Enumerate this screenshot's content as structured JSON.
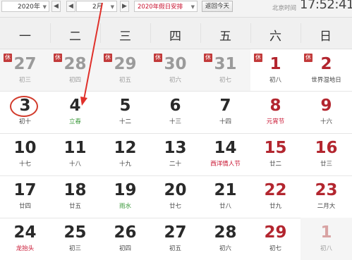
{
  "toolbar": {
    "year": "2020年",
    "month": "2月",
    "holiday_select": "2020年假日安排",
    "today_button": "返回今天",
    "timezone_label": "北京时间",
    "clock": "17:52:41",
    "prev_icon": "chevron-left-icon",
    "next_icon": "chevron-right-icon",
    "dropdown_icon": "caret-down-icon"
  },
  "weekdays": [
    "一",
    "二",
    "三",
    "四",
    "五",
    "六",
    "日"
  ],
  "colors": {
    "accent_red": "#c8102e",
    "weekend_red": "#b3262f",
    "solar_term_green": "#3d9a3d",
    "circle_red": "#d23b2c"
  },
  "rows": [
    [
      {
        "day": "27",
        "lunar": "初三",
        "badge": "休",
        "prev": true
      },
      {
        "day": "28",
        "lunar": "初四",
        "badge": "休",
        "prev": true
      },
      {
        "day": "29",
        "lunar": "初五",
        "badge": "休",
        "prev": true
      },
      {
        "day": "30",
        "lunar": "初六",
        "badge": "休",
        "prev": true
      },
      {
        "day": "31",
        "lunar": "初七",
        "badge": "休",
        "prev": true
      },
      {
        "day": "1",
        "lunar": "初八",
        "badge": "休"
      },
      {
        "day": "2",
        "lunar": "世界湿地日",
        "badge": "休"
      }
    ],
    [
      {
        "day": "3",
        "lunar": "初十",
        "circled": true
      },
      {
        "day": "4",
        "lunar": "立春",
        "kind": "term"
      },
      {
        "day": "5",
        "lunar": "十二"
      },
      {
        "day": "6",
        "lunar": "十三"
      },
      {
        "day": "7",
        "lunar": "十四"
      },
      {
        "day": "8",
        "lunar": "元宵节",
        "kind": "festival"
      },
      {
        "day": "9",
        "lunar": "十六"
      }
    ],
    [
      {
        "day": "10",
        "lunar": "十七"
      },
      {
        "day": "11",
        "lunar": "十八"
      },
      {
        "day": "12",
        "lunar": "十九"
      },
      {
        "day": "13",
        "lunar": "二十"
      },
      {
        "day": "14",
        "lunar": "西洋情人节",
        "kind": "festival"
      },
      {
        "day": "15",
        "lunar": "廿二"
      },
      {
        "day": "16",
        "lunar": "廿三"
      }
    ],
    [
      {
        "day": "17",
        "lunar": "廿四"
      },
      {
        "day": "18",
        "lunar": "廿五"
      },
      {
        "day": "19",
        "lunar": "雨水",
        "kind": "term"
      },
      {
        "day": "20",
        "lunar": "廿七"
      },
      {
        "day": "21",
        "lunar": "廿八"
      },
      {
        "day": "22",
        "lunar": "廿九"
      },
      {
        "day": "23",
        "lunar": "二月大"
      }
    ],
    [
      {
        "day": "24",
        "lunar": "龙抬头",
        "kind": "festival"
      },
      {
        "day": "25",
        "lunar": "初三"
      },
      {
        "day": "26",
        "lunar": "初四"
      },
      {
        "day": "27",
        "lunar": "初五"
      },
      {
        "day": "28",
        "lunar": "初六"
      },
      {
        "day": "29",
        "lunar": "初七"
      },
      {
        "day": "1",
        "lunar": "初八",
        "next": true
      }
    ]
  ]
}
